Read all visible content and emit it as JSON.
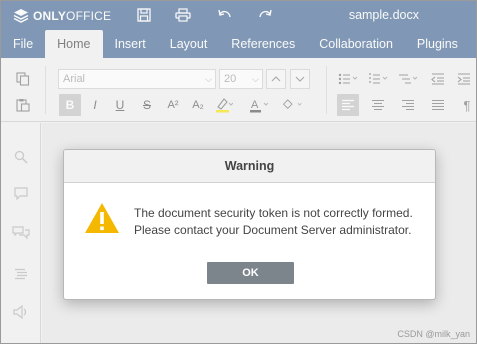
{
  "header": {
    "logo": {
      "bold": "ONLY",
      "rest": "OFFICE"
    },
    "document_title": "sample.docx",
    "icons": [
      "save-icon",
      "print-icon",
      "undo-icon",
      "redo-icon"
    ]
  },
  "tabs": [
    {
      "label": "File",
      "active": false
    },
    {
      "label": "Home",
      "active": true
    },
    {
      "label": "Insert",
      "active": false
    },
    {
      "label": "Layout",
      "active": false
    },
    {
      "label": "References",
      "active": false
    },
    {
      "label": "Collaboration",
      "active": false
    },
    {
      "label": "Plugins",
      "active": false
    }
  ],
  "toolbar": {
    "font_name": "Arial",
    "font_size": "20",
    "bold": "B",
    "italic": "I",
    "underline": "U",
    "strike": "S",
    "superscript": "A²",
    "subscript": "A₂",
    "font_color": "A",
    "paragraph_mark": "¶"
  },
  "dialog": {
    "title": "Warning",
    "message_line1": "The document security token is not correctly formed.",
    "message_line2": "Please contact your Document Server administrator.",
    "ok_label": "OK"
  },
  "watermark": "CSDN @milk_yan",
  "colors": {
    "header_bg": "#446995",
    "warning_icon": "#f5b800",
    "ok_button": "#7d858c"
  }
}
